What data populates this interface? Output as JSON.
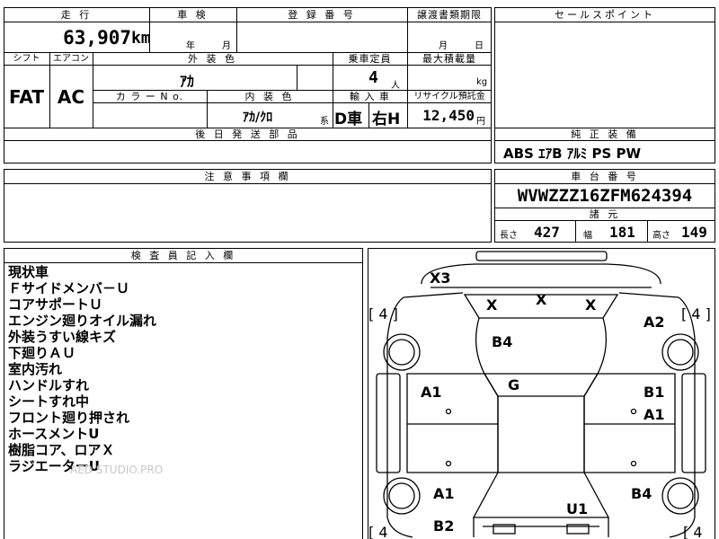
{
  "header": {
    "mileage_label": "走 行",
    "inspection_label": "車 検",
    "registration_label": "登 録 番 号",
    "transfer_label": "譲渡書類期限",
    "selling_points_label": "セールスポイント"
  },
  "mileage": {
    "value": "63,907",
    "unit": "km"
  },
  "inspection_date": {
    "year": "年",
    "month": "月"
  },
  "transfer_date": {
    "month": "月",
    "day": "日"
  },
  "spec_labels": {
    "shift": "シフト",
    "aircon": "エアコン",
    "exterior": "外 装 色",
    "capacity": "乗車定員",
    "max_load": "最大積載量",
    "color_no": "カ ラ ー N o.",
    "interior": "内 装 色",
    "import": "輸 入 車",
    "recycle": "リサイクル預託金"
  },
  "spec": {
    "shift": "FAT",
    "aircon": "AC",
    "exterior_color": "ｱｶ",
    "capacity": "4",
    "capacity_unit": "人",
    "load_unit": "kg",
    "interior_color": "ｱｶ/ｸﾛ",
    "interior_suffix": "系",
    "import_dealer": "D車",
    "steering": "右H",
    "recycle_fee": "12,450",
    "recycle_unit": "円"
  },
  "later_parts_label": "後 日 発 送 部 品",
  "equipment": {
    "label": "純 正 装 備",
    "items": "ABS ｴｱB ｱﾙﾐ PS PW"
  },
  "notes_label": "注 意 事 項 欄",
  "chassis": {
    "label": "車 台 番 号",
    "value": "WVWZZZ16ZFM624394"
  },
  "dimensions": {
    "label": "諸 元",
    "length_label": "長さ",
    "length": "427",
    "width_label": "幅",
    "width": "181",
    "height_label": "高さ",
    "height": "149"
  },
  "inspector": {
    "label": "検 査 員 記 入 欄",
    "lines": [
      "現状車",
      "Ｆサイドメンバ－Ｕ",
      "コアサポートＵ",
      "エンジン廻りオイル漏れ",
      "外装うすい線キズ",
      "下廻りＡＵ",
      "室内汚れ",
      "ハンドルすれ",
      "シートすれ中",
      "フロント廻り押され",
      "ホースメントU",
      "樹脂コア、ロアＸ",
      "ラジエーターU"
    ],
    "watermark": "AED STUDIO.PRO"
  },
  "diagram": {
    "front_marks": [
      "X3"
    ],
    "windshield_marks": [
      "X",
      "X",
      "X"
    ],
    "tire_marks": [
      "[ 4 ]",
      "[ 4 ]",
      "[ 4",
      "[ 4"
    ],
    "hood": "B4",
    "left_front_fender": "A1",
    "right_front_fender_a": "B1",
    "right_front_fender_b": "A1",
    "right_front_corner": "A2",
    "roof": "G",
    "left_rear_door": "A1",
    "left_rear_bottom": "B2",
    "right_rear_quarter": "B4",
    "trunk": "U1"
  }
}
